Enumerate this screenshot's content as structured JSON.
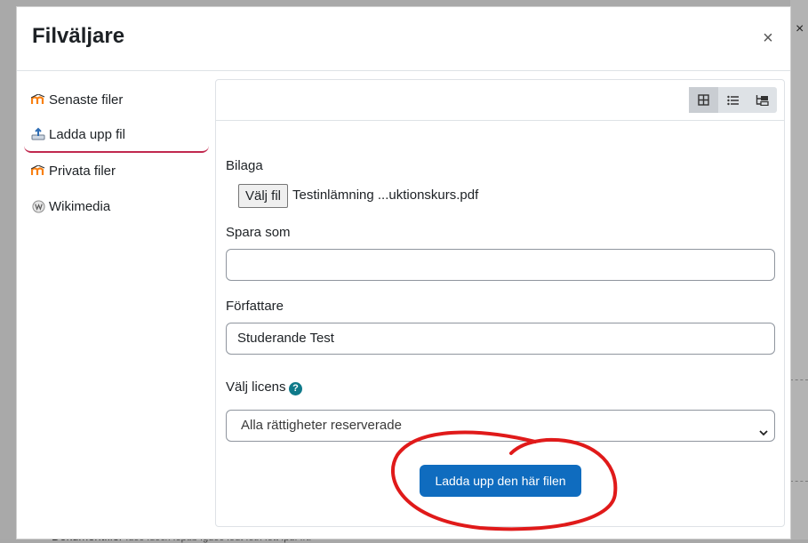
{
  "modal": {
    "title": "Filväljare",
    "close_symbol": "×"
  },
  "sidebar": {
    "items": [
      {
        "label": "Senaste filer",
        "icon": "moodle-icon",
        "active": false
      },
      {
        "label": "Ladda upp fil",
        "icon": "upload-icon",
        "active": true
      },
      {
        "label": "Privata filer",
        "icon": "moodle-icon",
        "active": false
      },
      {
        "label": "Wikimedia",
        "icon": "wikimedia-icon",
        "active": false
      }
    ]
  },
  "toolbar": {
    "views": [
      "grid-view-icon",
      "list-view-icon",
      "tree-view-icon"
    ],
    "active_view": "grid-view-icon"
  },
  "form": {
    "attachment_label": "Bilaga",
    "choose_file_button": "Välj fil",
    "file_name": "Testinlämning ...uktionskurs.pdf",
    "save_as_label": "Spara som",
    "save_as_value": "",
    "author_label": "Författare",
    "author_value": "Studerande Test",
    "license_label": "Välj licens",
    "help_symbol": "?",
    "license_value": "Alla rättigheter reserverade",
    "upload_button": "Ladda upp den här filen"
  },
  "background": {
    "bottom_text": "Dokumentfiler",
    "bottom_small": " .doc .docx .epub .gdoc .odt .oth .ott .pdf .rtf",
    "close_symbol": "×"
  },
  "colors": {
    "primary": "#0f6cbf",
    "active_underline": "#c1284e",
    "annotation": "#e01a1a"
  }
}
